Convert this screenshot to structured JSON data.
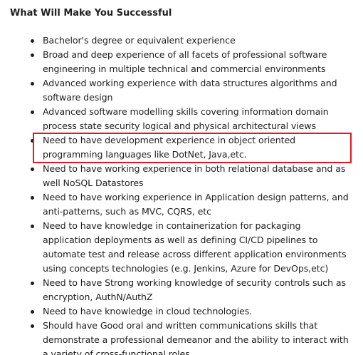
{
  "section": {
    "heading": "What Will Make You Successful",
    "items": [
      " Bachelor's degree or equivalent experience",
      " Broad and deep experience of all facets of professional software engineering in multiple technical and commercial environments",
      " Advanced working experience with data structures algorithms and software design",
      " Advanced software modelling skills covering information domain process state security logical and physical architectural views",
      " Need to have development experience in object oriented programming languages like DotNet, Java,etc.",
      " Need to have working experience in both relational database and as well NoSQL Datastores",
      " Need to have working experience in Application design patterns, and anti-patterns, such as MVC, CQRS, etc",
      " Need to have knowledge in containerization for packaging application deployments as well as defining CI/CD pipelines to automate test and release across different application environments using concepts technologies (e.g. Jenkins, Azure for DevOps,etc)",
      " Need to have Strong working knowledge of security controls such as encryption, AuthN/AuthZ",
      " Need to have knowledge in cloud technologies.",
      " Should have Good oral and written communications skills that demonstrate a professional demeanor and the ability to interact with a variety of cross-functional roles"
    ]
  },
  "annotation": {
    "highlight_color": "#e8141e",
    "highlighted_item_index": 4
  }
}
